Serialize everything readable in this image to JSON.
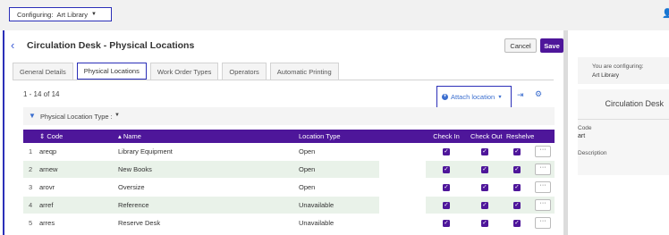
{
  "config": {
    "label": "Configuring:",
    "value": "Art Library"
  },
  "header": {
    "title": "Circulation Desk - Physical Locations",
    "cancel": "Cancel",
    "save": "Save"
  },
  "tabs": [
    {
      "label": "General Details"
    },
    {
      "label": "Physical Locations"
    },
    {
      "label": "Work Order Types"
    },
    {
      "label": "Operators"
    },
    {
      "label": "Automatic Printing"
    }
  ],
  "results": {
    "count": "1 - 14 of 14",
    "attach": "Attach location"
  },
  "filter": {
    "label": "Physical Location Type :"
  },
  "table": {
    "headers": {
      "code": "Code",
      "name": "Name",
      "type": "Location Type",
      "checkin": "Check In",
      "checkout": "Check Out",
      "reshelve": "Reshelve"
    },
    "rows": [
      {
        "num": "1",
        "code": "areqp",
        "name": "Library Equipment",
        "type": "Open"
      },
      {
        "num": "2",
        "code": "arnew",
        "name": "New Books",
        "type": "Open"
      },
      {
        "num": "3",
        "code": "arovr",
        "name": "Oversize",
        "type": "Open"
      },
      {
        "num": "4",
        "code": "arref",
        "name": "Reference",
        "type": "Unavailable"
      },
      {
        "num": "5",
        "code": "arres",
        "name": "Reserve Desk",
        "type": "Unavailable"
      }
    ]
  },
  "right_panel": {
    "configuring_label": "You are configuring:",
    "configuring_value": "Art Library",
    "card_title": "Circulation Desk",
    "code_label": "Code",
    "code_value": "art",
    "description_label": "Description"
  },
  "colors": {
    "purple": "#4e169a",
    "highlight_border": "#2b2fb8",
    "link_blue": "#3b6ecf",
    "row_alt": "#e9f2e9"
  },
  "icons": [
    "chevron-down-icon",
    "user-icon",
    "back-chevron-icon",
    "plus-circle-icon",
    "export-icon",
    "gear-icon",
    "filter-icon",
    "sort-icon",
    "checkbox-icon",
    "ellipsis-icon"
  ]
}
